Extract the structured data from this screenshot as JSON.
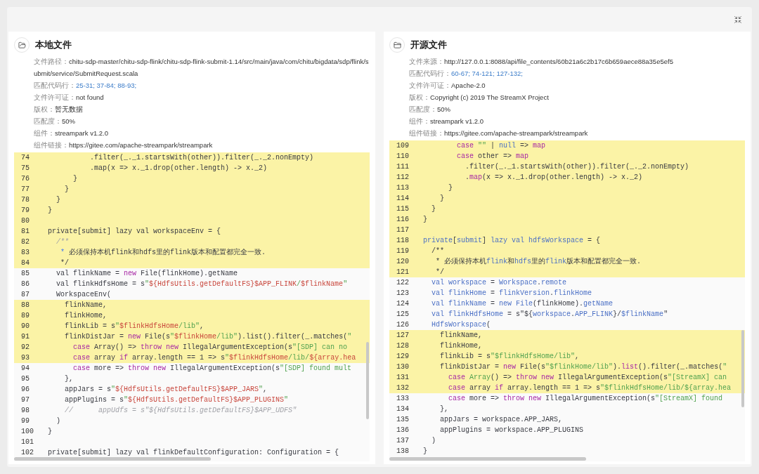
{
  "panels": [
    {
      "title": "本地文件",
      "fields": [
        {
          "label": "文件路径：",
          "value": "chitu-sdp-master/chitu-sdp-flink/chitu-sdp-flink-submit-1.14/src/main/java/com/chitu/bigdata/sdp/flink/submit/service/SubmitRequest.scala",
          "kind": "text"
        },
        {
          "label": "匹配代码行：",
          "value": "25-31; 37-84; 88-93;",
          "kind": "lines"
        },
        {
          "label": "文件许可证：",
          "value": "not found",
          "kind": "text"
        },
        {
          "label": "版权：",
          "value": "暂无数据",
          "kind": "text"
        },
        {
          "label": "匹配度：",
          "value": "50%",
          "kind": "text"
        },
        {
          "label": "组件：",
          "value": "streampark v1.2.0",
          "kind": "text"
        },
        {
          "label": "组件链接：",
          "value": "https://gitee.com/apache-streampark/streampark",
          "kind": "text"
        }
      ],
      "code": [
        {
          "number": "74",
          "highlighted": true,
          "tokens": [
            {
              "kind": "plain",
              "text": "            .filter(_._1.startsWith(other)).filter(_._2.nonEmpty)"
            }
          ]
        },
        {
          "number": "75",
          "highlighted": true,
          "tokens": [
            {
              "kind": "plain",
              "text": "            .map(x => x._1.drop(other.length) -> x._2)"
            }
          ]
        },
        {
          "number": "76",
          "highlighted": true,
          "tokens": [
            {
              "kind": "plain",
              "text": "        }"
            }
          ]
        },
        {
          "number": "77",
          "highlighted": true,
          "tokens": [
            {
              "kind": "plain",
              "text": "      }"
            }
          ]
        },
        {
          "number": "78",
          "highlighted": true,
          "tokens": [
            {
              "kind": "plain",
              "text": "    }"
            }
          ]
        },
        {
          "number": "79",
          "highlighted": true,
          "tokens": [
            {
              "kind": "plain",
              "text": "  }"
            }
          ]
        },
        {
          "number": "80",
          "highlighted": true
        },
        {
          "number": "81",
          "highlighted": true,
          "tokens": [
            {
              "kind": "plain",
              "text": "  private[submit] lazy val workspaceEnv = {"
            }
          ]
        },
        {
          "number": "82",
          "highlighted": true,
          "tokens": [
            {
              "kind": "comment",
              "text": "    /**"
            }
          ]
        },
        {
          "number": "83",
          "highlighted": true,
          "tokens": [
            {
              "kind": "symbol",
              "text": "     *"
            },
            {
              "kind": "plain",
              "text": " 必须保持本机flink和hdfs里的flink版本和配置都完全一致."
            }
          ]
        },
        {
          "number": "84",
          "highlighted": true,
          "tokens": [
            {
              "kind": "plain",
              "text": "     */"
            }
          ]
        },
        {
          "number": "85",
          "highlighted": false,
          "tokens": [
            {
              "kind": "plain",
              "text": "    val flinkName = "
            },
            {
              "kind": "keyword",
              "text": "new"
            },
            {
              "kind": "plain",
              "text": " File(flinkHome).getName"
            }
          ]
        },
        {
          "number": "86",
          "highlighted": false,
          "tokens": [
            {
              "kind": "plain",
              "text": "    val flinkHdfsHome = s"
            },
            {
              "kind": "string",
              "text": "\""
            },
            {
              "kind": "interp",
              "text": "${HdfsUtils.getDefaultFS}$APP_FLINK"
            },
            {
              "kind": "string",
              "text": "/"
            },
            {
              "kind": "interp",
              "text": "$flinkName"
            },
            {
              "kind": "string",
              "text": "\""
            }
          ]
        },
        {
          "number": "87",
          "highlighted": false,
          "tokens": [
            {
              "kind": "plain",
              "text": "    WorkspaceEnv("
            }
          ]
        },
        {
          "number": "88",
          "highlighted": true,
          "tokens": [
            {
              "kind": "plain",
              "text": "      flinkName,"
            }
          ]
        },
        {
          "number": "89",
          "highlighted": true,
          "tokens": [
            {
              "kind": "plain",
              "text": "      flinkHome,"
            }
          ]
        },
        {
          "number": "90",
          "highlighted": true,
          "tokens": [
            {
              "kind": "plain",
              "text": "      flinkLib = s"
            },
            {
              "kind": "string",
              "text": "\""
            },
            {
              "kind": "interp",
              "text": "$flinkHdfsHome"
            },
            {
              "kind": "string",
              "text": "/lib\""
            },
            {
              "kind": "plain",
              "text": ","
            }
          ]
        },
        {
          "number": "91",
          "highlighted": true,
          "tokens": [
            {
              "kind": "plain",
              "text": "      flinkDistJar = "
            },
            {
              "kind": "keyword",
              "text": "new"
            },
            {
              "kind": "plain",
              "text": " File(s"
            },
            {
              "kind": "string",
              "text": "\""
            },
            {
              "kind": "interp",
              "text": "$flinkHome"
            },
            {
              "kind": "string",
              "text": "/lib\""
            },
            {
              "kind": "plain",
              "text": ").list().filter(_.matches("
            },
            {
              "kind": "string",
              "text": "\""
            }
          ]
        },
        {
          "number": "92",
          "highlighted": true,
          "tokens": [
            {
              "kind": "keyword",
              "text": "        case"
            },
            {
              "kind": "plain",
              "text": " Array() => "
            },
            {
              "kind": "keyword",
              "text": "throw new"
            },
            {
              "kind": "plain",
              "text": " IllegalArgumentException(s"
            },
            {
              "kind": "string",
              "text": "\"[SDP] can no"
            }
          ]
        },
        {
          "number": "93",
          "highlighted": true,
          "tokens": [
            {
              "kind": "keyword",
              "text": "        case"
            },
            {
              "kind": "plain",
              "text": " array "
            },
            {
              "kind": "keyword",
              "text": "if"
            },
            {
              "kind": "plain",
              "text": " array.length == 1 => s"
            },
            {
              "kind": "string",
              "text": "\""
            },
            {
              "kind": "interp",
              "text": "$flinkHdfsHome"
            },
            {
              "kind": "string",
              "text": "/lib/"
            },
            {
              "kind": "interp",
              "text": "${array.hea"
            }
          ]
        },
        {
          "number": "94",
          "highlighted": false,
          "tokens": [
            {
              "kind": "keyword",
              "text": "        case"
            },
            {
              "kind": "plain",
              "text": " more => "
            },
            {
              "kind": "keyword",
              "text": "throw new"
            },
            {
              "kind": "plain",
              "text": " IllegalArgumentException(s"
            },
            {
              "kind": "string",
              "text": "\"[SDP] found mult"
            }
          ]
        },
        {
          "number": "95",
          "highlighted": false,
          "tokens": [
            {
              "kind": "plain",
              "text": "      },"
            }
          ]
        },
        {
          "number": "96",
          "highlighted": false,
          "tokens": [
            {
              "kind": "plain",
              "text": "      appJars = s"
            },
            {
              "kind": "string",
              "text": "\""
            },
            {
              "kind": "interp",
              "text": "${HdfsUtils.getDefaultFS}$APP_JARS"
            },
            {
              "kind": "string",
              "text": "\""
            },
            {
              "kind": "plain",
              "text": ","
            }
          ]
        },
        {
          "number": "97",
          "highlighted": false,
          "tokens": [
            {
              "kind": "plain",
              "text": "      appPlugins = s"
            },
            {
              "kind": "string",
              "text": "\""
            },
            {
              "kind": "interp",
              "text": "${HdfsUtils.getDefaultFS}$APP_PLUGINS"
            },
            {
              "kind": "string",
              "text": "\""
            }
          ]
        },
        {
          "number": "98",
          "highlighted": false,
          "tokens": [
            {
              "kind": "comment",
              "text": "      //      appUdfs = s\"${HdfsUtils.getDefaultFS}$APP_UDFS\""
            }
          ]
        },
        {
          "number": "99",
          "highlighted": false,
          "tokens": [
            {
              "kind": "plain",
              "text": "    )"
            }
          ]
        },
        {
          "number": "100",
          "highlighted": false,
          "tokens": [
            {
              "kind": "plain",
              "text": "  }"
            }
          ]
        },
        {
          "number": "101",
          "highlighted": false
        },
        {
          "number": "102",
          "highlighted": false,
          "tokens": [
            {
              "kind": "plain",
              "text": "  private[submit] lazy val flinkDefaultConfiguration: Configuration = {"
            }
          ]
        }
      ]
    },
    {
      "title": "开源文件",
      "fields": [
        {
          "label": "文件来源：",
          "value": "http://127.0.0.1:8088/api/file_contents/60b21a6c2b17c6b659aece88a35e5ef5",
          "kind": "text"
        },
        {
          "label": "匹配代码行：",
          "value": "60-67; 74-121; 127-132;",
          "kind": "lines"
        },
        {
          "label": "文件许可证：",
          "value": "Apache-2.0",
          "kind": "text"
        },
        {
          "label": "版权：",
          "value": "Copyright (c) 2019 The StreamX Project",
          "kind": "text"
        },
        {
          "label": "匹配度：",
          "value": "50%",
          "kind": "text"
        },
        {
          "label": "组件：",
          "value": "streampark v1.2.0",
          "kind": "text"
        },
        {
          "label": "组件链接：",
          "value": "https://gitee.com/apache-streampark/streampark",
          "kind": "text"
        }
      ],
      "code": [
        {
          "number": "109",
          "highlighted": true,
          "tokens": [
            {
              "kind": "keyword",
              "text": "          case"
            },
            {
              "kind": "string",
              "text": " \"\""
            },
            {
              "kind": "plain",
              "text": " | "
            },
            {
              "kind": "ident",
              "text": "null"
            },
            {
              "kind": "plain",
              "text": " => "
            },
            {
              "kind": "keyword",
              "text": "map"
            }
          ]
        },
        {
          "number": "110",
          "highlighted": true,
          "tokens": [
            {
              "kind": "keyword",
              "text": "          case"
            },
            {
              "kind": "plain",
              "text": " other => "
            },
            {
              "kind": "keyword",
              "text": "map"
            }
          ]
        },
        {
          "number": "111",
          "highlighted": true,
          "tokens": [
            {
              "kind": "plain",
              "text": "            .filter(_._1.startsWith(other)).filter(_._2.nonEmpty)"
            }
          ]
        },
        {
          "number": "112",
          "highlighted": true,
          "tokens": [
            {
              "kind": "plain",
              "text": "            ."
            },
            {
              "kind": "keyword",
              "text": "map"
            },
            {
              "kind": "plain",
              "text": "(x => x._1.drop(other.length) -> x._2)"
            }
          ]
        },
        {
          "number": "113",
          "highlighted": true,
          "tokens": [
            {
              "kind": "plain",
              "text": "        }"
            }
          ]
        },
        {
          "number": "114",
          "highlighted": true,
          "tokens": [
            {
              "kind": "plain",
              "text": "      }"
            }
          ]
        },
        {
          "number": "115",
          "highlighted": true,
          "tokens": [
            {
              "kind": "plain",
              "text": "    }"
            }
          ]
        },
        {
          "number": "116",
          "highlighted": true,
          "tokens": [
            {
              "kind": "plain",
              "text": "  }"
            }
          ]
        },
        {
          "number": "117",
          "highlighted": true
        },
        {
          "number": "118",
          "highlighted": true,
          "tokens": [
            {
              "kind": "ident",
              "text": "  private"
            },
            {
              "kind": "plain",
              "text": "["
            },
            {
              "kind": "ident",
              "text": "submit"
            },
            {
              "kind": "plain",
              "text": "] "
            },
            {
              "kind": "ident",
              "text": "lazy val hdfsWorkspace"
            },
            {
              "kind": "plain",
              "text": " = {"
            }
          ]
        },
        {
          "number": "119",
          "highlighted": true,
          "tokens": [
            {
              "kind": "plain",
              "text": "    /**"
            }
          ]
        },
        {
          "number": "120",
          "highlighted": true,
          "tokens": [
            {
              "kind": "plain",
              "text": "     * 必须保持本机"
            },
            {
              "kind": "ident",
              "text": "flink"
            },
            {
              "kind": "plain",
              "text": "和"
            },
            {
              "kind": "ident",
              "text": "hdfs"
            },
            {
              "kind": "plain",
              "text": "里的"
            },
            {
              "kind": "ident",
              "text": "flink"
            },
            {
              "kind": "plain",
              "text": "版本和配置都完全一致."
            }
          ]
        },
        {
          "number": "121",
          "highlighted": true,
          "tokens": [
            {
              "kind": "plain",
              "text": "     */"
            }
          ]
        },
        {
          "number": "122",
          "highlighted": false,
          "tokens": [
            {
              "kind": "ident",
              "text": "    val workspace"
            },
            {
              "kind": "plain",
              "text": " = "
            },
            {
              "kind": "ident",
              "text": "Workspace"
            },
            {
              "kind": "plain",
              "text": "."
            },
            {
              "kind": "ident",
              "text": "remote"
            }
          ]
        },
        {
          "number": "123",
          "highlighted": false,
          "tokens": [
            {
              "kind": "ident",
              "text": "    val flinkHome"
            },
            {
              "kind": "plain",
              "text": " = "
            },
            {
              "kind": "ident",
              "text": "flinkVersion"
            },
            {
              "kind": "plain",
              "text": "."
            },
            {
              "kind": "ident",
              "text": "flinkHome"
            }
          ]
        },
        {
          "number": "124",
          "highlighted": false,
          "tokens": [
            {
              "kind": "ident",
              "text": "    val flinkName"
            },
            {
              "kind": "plain",
              "text": " = "
            },
            {
              "kind": "ident",
              "text": "new File"
            },
            {
              "kind": "plain",
              "text": "(flinkHome)."
            },
            {
              "kind": "ident",
              "text": "getName"
            }
          ]
        },
        {
          "number": "125",
          "highlighted": false,
          "tokens": [
            {
              "kind": "ident",
              "text": "    val flinkHdfsHome"
            },
            {
              "kind": "plain",
              "text": " = s\"${"
            },
            {
              "kind": "ident",
              "text": "workspace"
            },
            {
              "kind": "plain",
              "text": "."
            },
            {
              "kind": "ident",
              "text": "APP_FLINK"
            },
            {
              "kind": "plain",
              "text": "}/"
            },
            {
              "kind": "ident",
              "text": "$flinkName"
            },
            {
              "kind": "plain",
              "text": "\""
            }
          ]
        },
        {
          "number": "126",
          "highlighted": false,
          "tokens": [
            {
              "kind": "ident",
              "text": "    HdfsWorkspace"
            },
            {
              "kind": "plain",
              "text": "("
            }
          ]
        },
        {
          "number": "127",
          "highlighted": true,
          "tokens": [
            {
              "kind": "plain",
              "text": "      flinkName,"
            }
          ]
        },
        {
          "number": "128",
          "highlighted": true,
          "tokens": [
            {
              "kind": "plain",
              "text": "      flinkHome,"
            }
          ]
        },
        {
          "number": "129",
          "highlighted": true,
          "tokens": [
            {
              "kind": "plain",
              "text": "      flinkLib = s"
            },
            {
              "kind": "string",
              "text": "\"$flinkHdfsHome/lib\""
            },
            {
              "kind": "plain",
              "text": ","
            }
          ]
        },
        {
          "number": "130",
          "highlighted": true,
          "tokens": [
            {
              "kind": "plain",
              "text": "      flinkDistJar = "
            },
            {
              "kind": "keyword",
              "text": "new"
            },
            {
              "kind": "plain",
              "text": " File(s"
            },
            {
              "kind": "string",
              "text": "\"$flinkHome/lib\""
            },
            {
              "kind": "plain",
              "text": ")."
            },
            {
              "kind": "keyword",
              "text": "list"
            },
            {
              "kind": "plain",
              "text": "().filter(_.matches("
            },
            {
              "kind": "string",
              "text": "\""
            }
          ]
        },
        {
          "number": "131",
          "highlighted": true,
          "tokens": [
            {
              "kind": "keyword",
              "text": "        case"
            },
            {
              "kind": "string",
              "text": " Array"
            },
            {
              "kind": "plain",
              "text": "() => "
            },
            {
              "kind": "keyword",
              "text": "throw new"
            },
            {
              "kind": "plain",
              "text": " IllegalArgumentException(s"
            },
            {
              "kind": "string",
              "text": "\"[StreamX] can"
            }
          ]
        },
        {
          "number": "132",
          "highlighted": true,
          "tokens": [
            {
              "kind": "keyword",
              "text": "        case"
            },
            {
              "kind": "plain",
              "text": " array "
            },
            {
              "kind": "keyword",
              "text": "if"
            },
            {
              "kind": "plain",
              "text": " array.length == 1 => s"
            },
            {
              "kind": "string",
              "text": "\"$flinkHdfsHome/lib/${array.hea"
            }
          ]
        },
        {
          "number": "133",
          "highlighted": false,
          "tokens": [
            {
              "kind": "keyword",
              "text": "        case"
            },
            {
              "kind": "plain",
              "text": " more => "
            },
            {
              "kind": "keyword",
              "text": "throw new"
            },
            {
              "kind": "plain",
              "text": " IllegalArgumentException(s"
            },
            {
              "kind": "string",
              "text": "\"[StreamX] found"
            }
          ]
        },
        {
          "number": "134",
          "highlighted": false,
          "tokens": [
            {
              "kind": "plain",
              "text": "      },"
            }
          ]
        },
        {
          "number": "135",
          "highlighted": false,
          "tokens": [
            {
              "kind": "plain",
              "text": "      appJars = workspace.APP_JARS,"
            }
          ]
        },
        {
          "number": "136",
          "highlighted": false,
          "tokens": [
            {
              "kind": "plain",
              "text": "      appPlugins = workspace.APP_PLUGINS"
            }
          ]
        },
        {
          "number": "137",
          "highlighted": false,
          "tokens": [
            {
              "kind": "plain",
              "text": "    )"
            }
          ]
        },
        {
          "number": "138",
          "highlighted": false,
          "tokens": [
            {
              "kind": "plain",
              "text": "  }"
            }
          ]
        }
      ]
    }
  ]
}
